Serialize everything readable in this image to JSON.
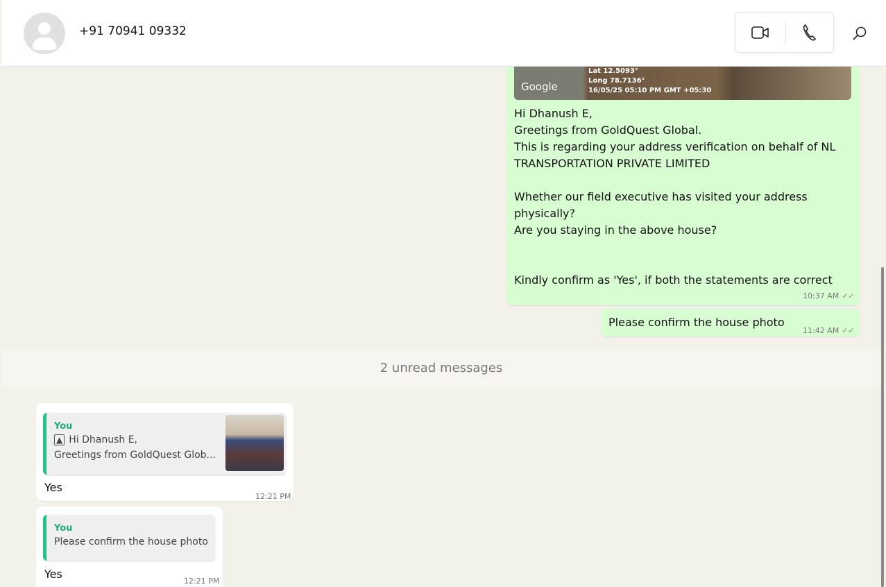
{
  "header": {
    "title": "+91 70941 09332",
    "video_icon": "video-camera-icon",
    "phone_icon": "phone-icon",
    "search_icon": "search-icon"
  },
  "image_overlay": {
    "lat": "Lat 12.5093°",
    "long": "Long 78.7136°",
    "datetime": "16/05/25 05:10 PM GMT +05:30",
    "map_brand": "Google"
  },
  "messages_out": [
    {
      "lines": [
        "Hi Dhanush E,",
        "Greetings from GoldQuest Global.",
        "This is regarding your address verification on behalf of NL",
        "TRANSPORTATION PRIVATE LIMITED",
        "",
        "Whether our field executive has visited your address",
        "physically?",
        "Are you staying in the above house?",
        "",
        "",
        "Kindly confirm as 'Yes', if both the statements are correct"
      ],
      "time": "10:37 AM"
    },
    {
      "text": "Please confirm the house photo",
      "time": "11:42 AM"
    }
  ],
  "divider": "2 unread messages",
  "messages_in": [
    {
      "quote_name": "You",
      "quote_line1": "Hi Dhanush E,",
      "quote_line2": "Greetings from GoldQuest Glob...",
      "text": "Yes",
      "time": "12:21 PM"
    },
    {
      "quote_name": "You",
      "quote_line1": "Please confirm the house photo",
      "text": "Yes",
      "time": "12:21 PM"
    }
  ]
}
